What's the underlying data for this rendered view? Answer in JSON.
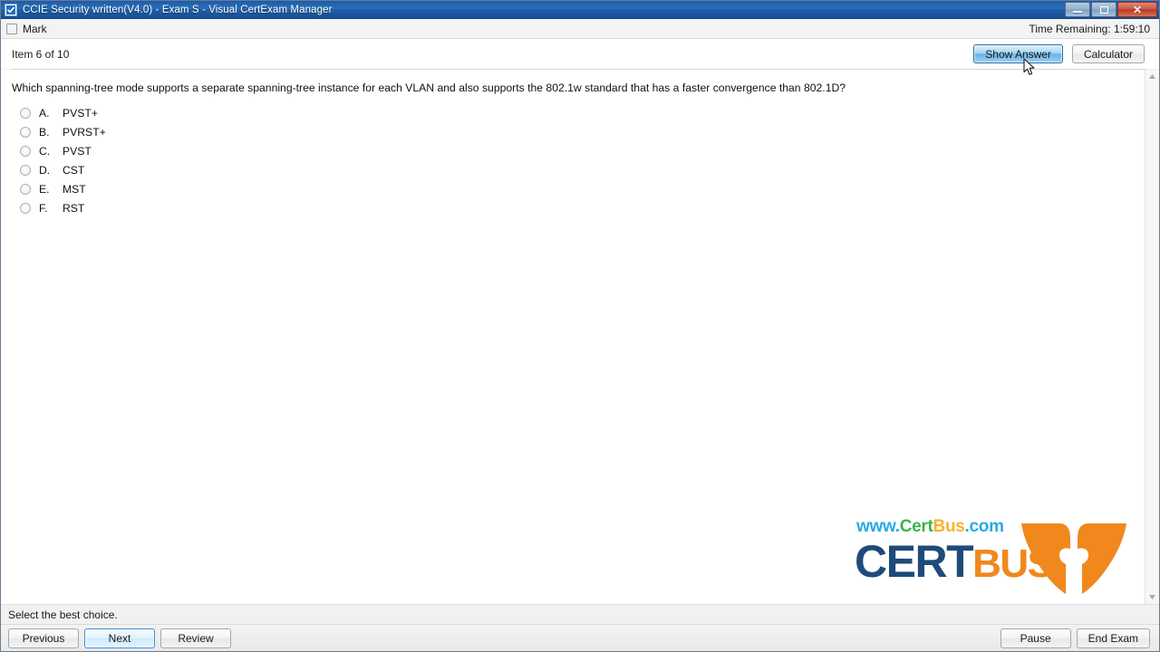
{
  "window": {
    "title": "CCIE Security written(V4.0) - Exam S - Visual CertExam Manager",
    "icon": "checkbox-app-icon",
    "controls": {
      "minimize": "–",
      "maximize": "□",
      "close": "✕"
    }
  },
  "markbar": {
    "mark_label": "Mark",
    "mark_checked": false,
    "timer_label": "Time Remaining: 1:59:10"
  },
  "toolbar": {
    "item_counter": "Item 6 of 10",
    "show_answer_label": "Show Answer",
    "calculator_label": "Calculator"
  },
  "question": {
    "text": "Which spanning-tree mode supports a separate spanning-tree instance for each VLAN and also supports the 802.1w standard that has a faster convergence than 802.1D?",
    "options": [
      {
        "letter": "A.",
        "text": "PVST+",
        "selected": false
      },
      {
        "letter": "B.",
        "text": "PVRST+",
        "selected": false
      },
      {
        "letter": "C.",
        "text": "PVST",
        "selected": false
      },
      {
        "letter": "D.",
        "text": "CST",
        "selected": false
      },
      {
        "letter": "E.",
        "text": "MST",
        "selected": false
      },
      {
        "letter": "F.",
        "text": "RST",
        "selected": false
      }
    ]
  },
  "logo": {
    "url_www": "www.",
    "url_cert": "Cert",
    "url_bus": "Bus",
    "url_com": ".com",
    "word_cert": "CERT",
    "word_bus": "BUS",
    "colors": {
      "blue": "#29abe2",
      "green": "#39b54a",
      "yellow": "#f7b32b",
      "navy": "#1f4b7a",
      "orange": "#f0881e"
    }
  },
  "scrollbar": {
    "up_arrow": "▲",
    "down_arrow": "▼"
  },
  "statusbar": {
    "text": "Select the best choice."
  },
  "bottombar": {
    "previous_label": "Previous",
    "next_label": "Next",
    "review_label": "Review",
    "pause_label": "Pause",
    "end_exam_label": "End Exam"
  }
}
